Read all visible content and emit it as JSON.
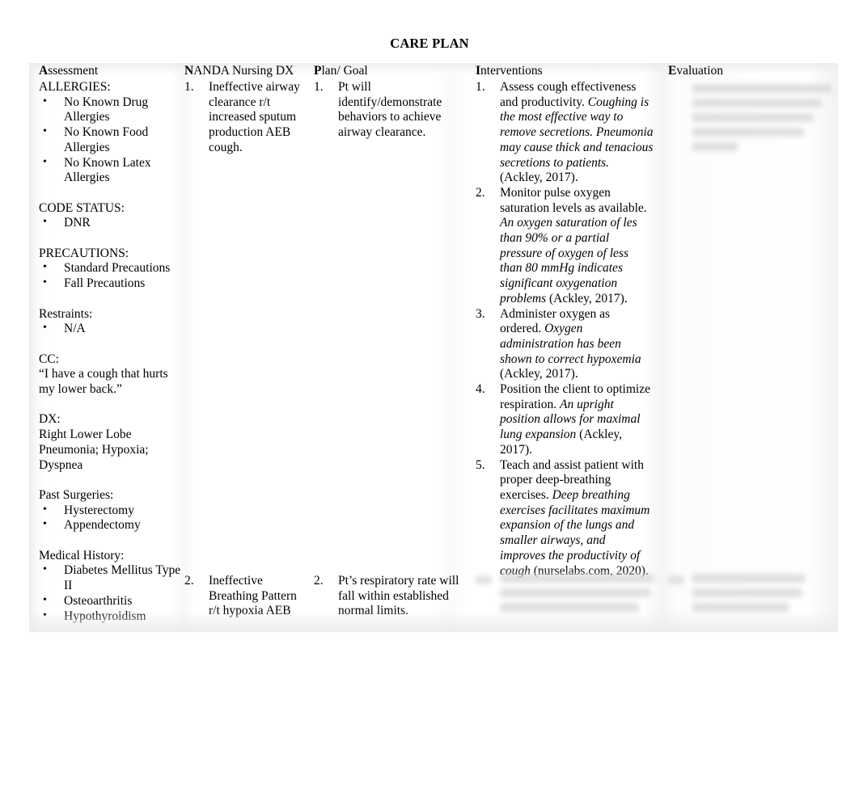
{
  "document": {
    "title": "CARE PLAN"
  },
  "columns": {
    "assessment": {
      "head_bold": "A",
      "head_rest": "ssessment"
    },
    "nanda": {
      "head_bold": "N",
      "head_rest": "ANDA Nursing DX"
    },
    "plan": {
      "head_bold": "P",
      "head_rest": "lan/ Goal"
    },
    "interventions": {
      "head_bold": "I",
      "head_rest": "nterventions"
    },
    "evaluation": {
      "head_bold": "E",
      "head_rest": "valuation"
    }
  },
  "assessment": {
    "allergies_label": "ALLERGIES:",
    "allergies": [
      "No Known Drug Allergies",
      "No Known Food Allergies",
      "No Known Latex Allergies"
    ],
    "code_status_label": "CODE STATUS:",
    "code_status": [
      "DNR"
    ],
    "precautions_label": "PRECAUTIONS:",
    "precautions": [
      "Standard Precautions",
      "Fall Precautions"
    ],
    "restraints_label": "Restraints:",
    "restraints": [
      "N/A"
    ],
    "cc_label": "CC:",
    "cc_text": "“I have a cough that hurts my lower back.”",
    "dx_label": "DX:",
    "dx_text": "Right Lower Lobe Pneumonia; Hypoxia; Dyspnea",
    "past_surgeries_label": "Past Surgeries:",
    "past_surgeries": [
      "Hysterectomy",
      "Appendectomy"
    ],
    "medical_history_label": "Medical History:",
    "medical_history": [
      "Diabetes Mellitus Type II",
      "Osteoarthritis",
      "Hypothyroidism"
    ]
  },
  "nanda_dx": [
    {
      "num": "1.",
      "text": "Ineffective airway clearance r/t increased sputum production AEB cough."
    },
    {
      "num": "2.",
      "text": "Ineffective Breathing Pattern r/t hypoxia AEB"
    }
  ],
  "plan_goal": [
    {
      "num": "1.",
      "text": "Pt will identify/demonstrate behaviors to achieve airway clearance."
    },
    {
      "num": "2.",
      "text": "Pt’s respiratory rate will fall within established normal limits."
    }
  ],
  "interventions": [
    {
      "num": "1.",
      "action": "Assess cough effectiveness and productivity. ",
      "rationale": "Coughing is the most effective way to remove secretions. Pneumonia may cause thick and tenacious secretions to patients.",
      "citation": " (Ackley, 2017)."
    },
    {
      "num": "2.",
      "action": "Monitor pulse oxygen saturation levels as available. ",
      "rationale": "An oxygen saturation of les than 90% or a partial pressure of oxygen of less than 80 mmHg indicates significant oxygenation problems",
      "citation": " (Ackley, 2017)."
    },
    {
      "num": "3.",
      "action": "Administer oxygen as ordered. ",
      "rationale": "Oxygen administration has been shown to correct hypoxemia",
      "citation": " (Ackley, 2017)."
    },
    {
      "num": "4.",
      "action": "Position the client to optimize respiration. ",
      "rationale": "An upright position allows for maximal lung expansion",
      "citation": " (Ackley, 2017)."
    },
    {
      "num": "5.",
      "action": "Teach and assist patient with proper deep-breathing exercises. ",
      "rationale": "Deep breathing exercises facilitates maximum expansion of the lungs and smaller airways, and improves the productivity of cough",
      "citation": " (nurselabs.com, 2020)."
    }
  ],
  "redacted": {
    "note": "blurred",
    "evaluation_row1_lines": 5,
    "interventions_row2_lines": 3,
    "evaluation_row2_lines": 3
  }
}
